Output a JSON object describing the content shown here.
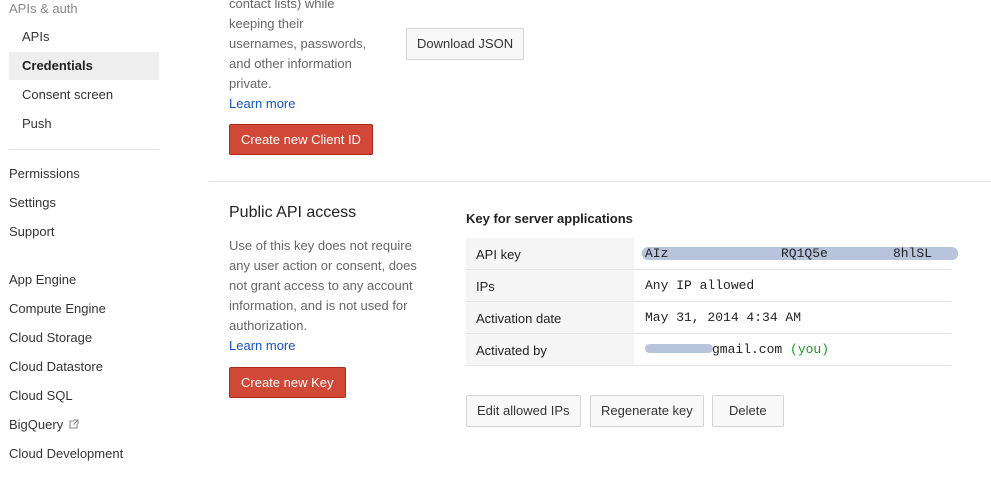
{
  "sidebar": {
    "header": "APIs & auth",
    "sub_items": [
      {
        "label": "APIs"
      },
      {
        "label": "Credentials",
        "active": true
      },
      {
        "label": "Consent screen"
      },
      {
        "label": "Push"
      }
    ],
    "items": [
      {
        "label": "Permissions"
      },
      {
        "label": "Settings"
      },
      {
        "label": "Support"
      }
    ],
    "products": [
      {
        "label": "App Engine"
      },
      {
        "label": "Compute Engine"
      },
      {
        "label": "Cloud Storage"
      },
      {
        "label": "Cloud Datastore"
      },
      {
        "label": "Cloud SQL"
      },
      {
        "label": "BigQuery",
        "icon": "external-link-icon"
      },
      {
        "label": "Cloud Development"
      }
    ]
  },
  "oauth": {
    "description_lines": [
      "contact lists) while",
      "keeping their",
      "usernames, passwords,",
      "and other information",
      "private."
    ],
    "learn_more": "Learn more",
    "create_button": "Create new Client ID",
    "download_button": "Download JSON"
  },
  "public_api": {
    "title": "Public API access",
    "description_lines": [
      "Use of this key does not require",
      "any user action or consent, does",
      "not grant access to any account",
      "information, and is not used for",
      "authorization."
    ],
    "learn_more": "Learn more",
    "create_button": "Create new Key",
    "key_section_title": "Key for server applications",
    "rows": [
      {
        "label": "API key",
        "value_start": "AIz",
        "value_middle": "RQ1Q5e",
        "value_end": "8hlSL"
      },
      {
        "label": "IPs",
        "value": "Any IP allowed"
      },
      {
        "label": "Activation date",
        "value": "May 31, 2014 4:34 AM"
      },
      {
        "label": "Activated by",
        "value": "gmail.com",
        "value_suffix": "(you)"
      }
    ],
    "buttons": {
      "edit_ips": "Edit allowed IPs",
      "regenerate": "Regenerate key",
      "delete": "Delete"
    }
  },
  "colors": {
    "primary_button": "#d14836",
    "link": "#1155cc",
    "you_text": "#229922"
  }
}
